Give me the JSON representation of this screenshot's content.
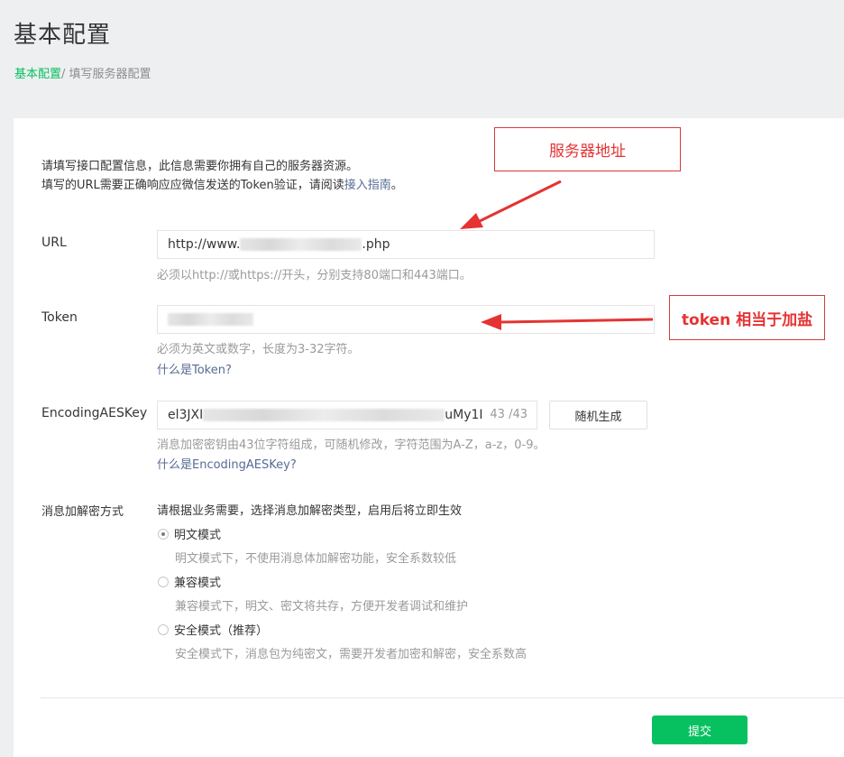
{
  "header": {
    "title": "基本配置",
    "breadcrumb": {
      "link": "基本配置",
      "separator": "/ ",
      "current": "填写服务器配置"
    }
  },
  "intro": {
    "line1": "请填写接口配置信息，此信息需要你拥有自己的服务器资源。",
    "line2_prefix": "填写的URL需要正确响应应微信发送的Token验证，请阅读",
    "guide_link": "接入指南",
    "line2_suffix": "。"
  },
  "form": {
    "url": {
      "label": "URL",
      "value_prefix": "http://www.",
      "value_suffix": ".php",
      "hint": "必须以http://或https://开头，分别支持80端口和443端口。"
    },
    "token": {
      "label": "Token",
      "hint": "必须为英文或数字，长度为3-32字符。",
      "help_link": "什么是Token?"
    },
    "aes": {
      "label": "EncodingAESKey",
      "value_prefix": "el3JXI",
      "value_suffix": "uMy1I",
      "count": "43",
      "max": "/43",
      "generate_label": "随机生成",
      "hint": "消息加密密钥由43位字符组成，可随机修改，字符范围为A-Z，a-z，0-9。",
      "help_link": "什么是EncodingAESKey?"
    },
    "encryption": {
      "label": "消息加解密方式",
      "desc": "请根据业务需要，选择消息加解密类型，启用后将立即生效",
      "options": [
        {
          "label": "明文模式",
          "desc": "明文模式下，不使用消息体加解密功能，安全系数较低",
          "selected": true
        },
        {
          "label": "兼容模式",
          "desc": "兼容模式下，明文、密文将共存，方便开发者调试和维护",
          "selected": false
        },
        {
          "label": "安全模式（推荐）",
          "desc": "安全模式下，消息包为纯密文，需要开发者加密和解密，安全系数高",
          "selected": false
        }
      ]
    },
    "submit_label": "提交"
  },
  "annotations": {
    "server": "服务器地址",
    "token": "token 相当于加盐"
  },
  "colors": {
    "accent": "#07c160",
    "link": "#576b95",
    "annotation": "#e53333"
  }
}
